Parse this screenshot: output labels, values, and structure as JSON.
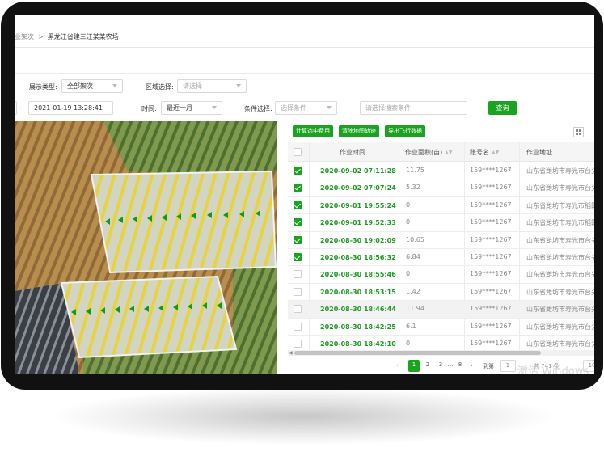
{
  "breadcrumb": {
    "prev": "业架次",
    "separator": ">",
    "current": "黑龙江省建三江某某农场"
  },
  "filters": {
    "display_type_label": "展示类型:",
    "display_type_value": "全部架次",
    "region_label": "区域选择:",
    "region_placeholder": "请选择",
    "date_tilde": "~",
    "date_end": "2021-01-19 13:28:41",
    "time_label": "时间:",
    "time_value": "最近一月",
    "condition_label": "条件选择:",
    "condition_placeholder": "选择条件",
    "search_placeholder": "请选择搜索条件",
    "query_button": "查询"
  },
  "toolbar": {
    "calc_fee": "计算选中费用",
    "clear_track": "清除地图轨迹",
    "export_flight": "导出飞行数据"
  },
  "table": {
    "columns": [
      "作业时间",
      "作业面积(亩)",
      "账号名",
      "作业地址"
    ],
    "rows": [
      {
        "time": "2020-09-02 07:11:28",
        "area": "11.75",
        "account": "159****1267",
        "address": "山东省潍坊市寿光市台头",
        "checked": true
      },
      {
        "time": "2020-09-02 07:07:24",
        "area": "5.32",
        "account": "159****1267",
        "address": "山东省潍坊市寿光市台头",
        "checked": true
      },
      {
        "time": "2020-09-01 19:55:24",
        "area": "0",
        "account": "159****1267",
        "address": "山东省潍坊市寿光市稻田",
        "checked": true
      },
      {
        "time": "2020-09-01 19:52:33",
        "area": "0",
        "account": "159****1267",
        "address": "山东省潍坊市寿光市稻田",
        "checked": true
      },
      {
        "time": "2020-08-30 19:02:09",
        "area": "10.65",
        "account": "159****1267",
        "address": "山东省潍坊市寿光市台头",
        "checked": true
      },
      {
        "time": "2020-08-30 18:56:32",
        "area": "6.84",
        "account": "159****1267",
        "address": "山东省潍坊市寿光市台头",
        "checked": true
      },
      {
        "time": "2020-08-30 18:55:46",
        "area": "0",
        "account": "159****1267",
        "address": "山东省潍坊市寿光市台头",
        "checked": false
      },
      {
        "time": "2020-08-30 18:53:15",
        "area": "1.42",
        "account": "159****1267",
        "address": "山东省潍坊市寿光市台头",
        "checked": false
      },
      {
        "time": "2020-08-30 18:46:44",
        "area": "11.94",
        "account": "159****1267",
        "address": "山东省潍坊市寿光市台头",
        "checked": false,
        "highlight": true
      },
      {
        "time": "2020-08-30 18:42:25",
        "area": "6.1",
        "account": "159****1267",
        "address": "山东省潍坊市寿光市台头",
        "checked": false
      },
      {
        "time": "2020-08-30 18:42:10",
        "area": "0",
        "account": "159****1267",
        "address": "山东省潍坊市寿光市台头",
        "checked": false
      }
    ]
  },
  "pagination": {
    "pages": [
      "1",
      "2",
      "3",
      "...",
      "8"
    ],
    "current": "1",
    "goto_label": "到第",
    "goto_value": "1",
    "total_text": "共 741 条",
    "page_size": "10"
  },
  "watermark": "激活 Windows",
  "colors": {
    "accent": "#1aa31e",
    "time_text": "#1d9a22"
  }
}
